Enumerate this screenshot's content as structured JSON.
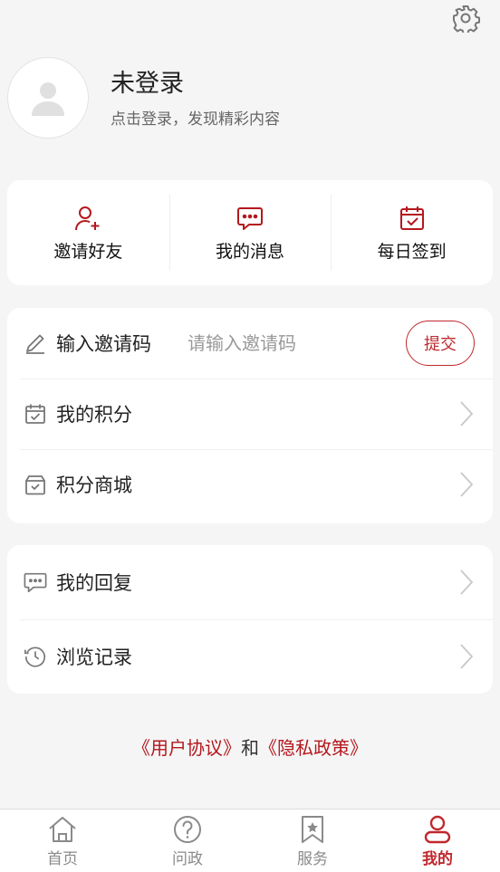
{
  "profile": {
    "name": "未登录",
    "subtitle": "点击登录，发现精彩内容"
  },
  "quick_actions": [
    {
      "label": "邀请好友",
      "icon": "add-user-icon"
    },
    {
      "label": "我的消息",
      "icon": "message-icon"
    },
    {
      "label": "每日签到",
      "icon": "calendar-check-icon"
    }
  ],
  "invite": {
    "label": "输入邀请码",
    "placeholder": "请输入邀请码",
    "submit_label": "提交"
  },
  "list1": [
    {
      "label": "我的积分",
      "icon": "points-calendar-icon"
    },
    {
      "label": "积分商城",
      "icon": "gift-box-icon"
    }
  ],
  "list2": [
    {
      "label": "我的回复",
      "icon": "reply-chat-icon"
    },
    {
      "label": "浏览记录",
      "icon": "history-clock-icon"
    }
  ],
  "agreement": {
    "user_agreement": "《用户协议》",
    "and": "和",
    "privacy_policy": "《隐私政策》"
  },
  "tabs": [
    {
      "label": "首页",
      "icon": "home-icon",
      "active": false
    },
    {
      "label": "问政",
      "icon": "question-icon",
      "active": false
    },
    {
      "label": "服务",
      "icon": "bookmark-star-icon",
      "active": false
    },
    {
      "label": "我的",
      "icon": "user-icon",
      "active": true
    }
  ],
  "colors": {
    "accent": "#c0282d",
    "background": "#f5f5f5",
    "link": "#b3181e"
  }
}
